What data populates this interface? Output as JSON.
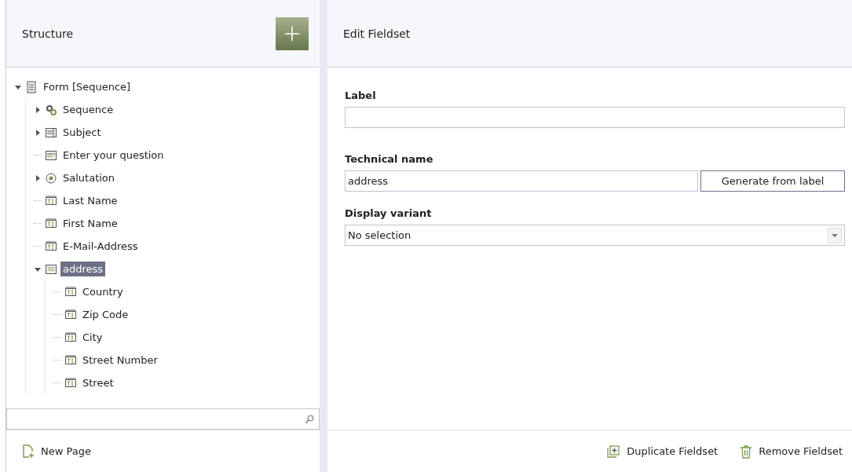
{
  "structure": {
    "title": "Structure",
    "tree": [
      {
        "label": "Form [Sequence]",
        "kind": "form",
        "selected": false,
        "expanded": true,
        "children": [
          {
            "label": "Sequence",
            "kind": "sequence",
            "selected": false,
            "expanded": false
          },
          {
            "label": "Subject",
            "kind": "select",
            "selected": false,
            "expanded": false
          },
          {
            "label": "Enter your question",
            "kind": "textarea",
            "selected": false
          },
          {
            "label": "Salutation",
            "kind": "radio",
            "selected": false,
            "expanded": false
          },
          {
            "label": "Last Name",
            "kind": "text",
            "selected": false
          },
          {
            "label": "First Name",
            "kind": "text",
            "selected": false
          },
          {
            "label": "E-Mail-Address",
            "kind": "text",
            "selected": false
          },
          {
            "label": "address",
            "kind": "fieldset",
            "selected": true,
            "expanded": true,
            "children": [
              {
                "label": "Country",
                "kind": "text",
                "selected": false
              },
              {
                "label": "Zip Code",
                "kind": "text",
                "selected": false
              },
              {
                "label": "City",
                "kind": "text",
                "selected": false
              },
              {
                "label": "Street Number",
                "kind": "text",
                "selected": false
              },
              {
                "label": "Street",
                "kind": "text",
                "selected": false
              }
            ]
          }
        ]
      }
    ],
    "new_page": "New Page"
  },
  "editor": {
    "title": "Edit Fieldset",
    "label_field": {
      "label": "Label"
    },
    "technical_name": {
      "label": "Technical name",
      "value": "address",
      "button": "Generate from label"
    },
    "display_variant": {
      "label": "Display variant",
      "value": "No selection"
    },
    "actions": [
      "Duplicate Fieldset",
      "Remove Fieldset"
    ]
  }
}
